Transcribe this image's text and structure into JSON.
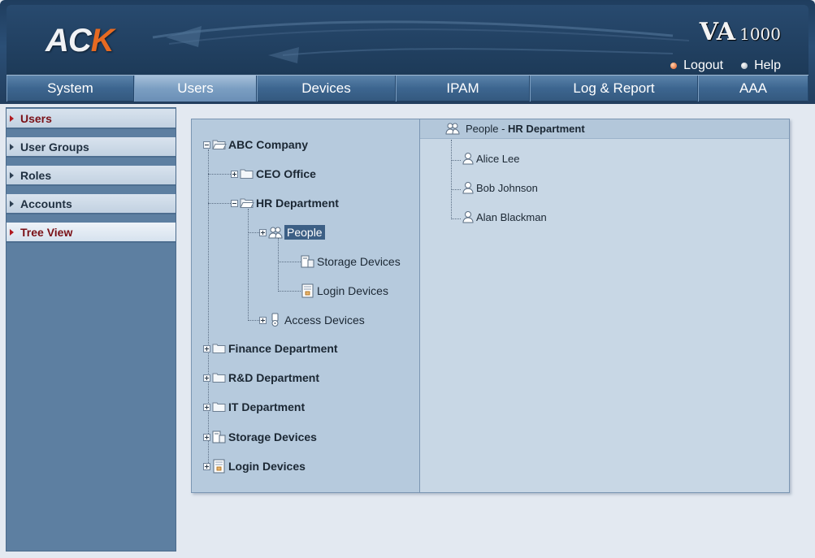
{
  "header": {
    "logo": "ACK",
    "brand_va": "VA",
    "brand_num": "1000",
    "logout": "Logout",
    "help": "Help",
    "colors": {
      "header_bg": "#223e5e",
      "logo_accent": "#e66a22"
    }
  },
  "nav": [
    "System",
    "Users",
    "Devices",
    "IPAM",
    "Log & Report",
    "AAA"
  ],
  "nav_active": "Users",
  "sidebar": {
    "items": [
      "Users",
      "User Groups",
      "Roles",
      "Accounts",
      "Tree View"
    ],
    "active": "Tree View"
  },
  "tree": {
    "root": "ABC Company",
    "ceo": "CEO Office",
    "hr": "HR Department",
    "people": "People",
    "storage_child": "Storage Devices",
    "login_child": "Login Devices",
    "access": "Access Devices",
    "finance": "Finance Department",
    "rd": "R&D Department",
    "it": "IT Department",
    "storage_top": "Storage Devices",
    "login_top": "Login Devices"
  },
  "detail": {
    "title": "People - ",
    "title_bold": "HR Department",
    "members": [
      "Alice Lee",
      "Bob Johnson",
      "Alan Blackman"
    ]
  }
}
